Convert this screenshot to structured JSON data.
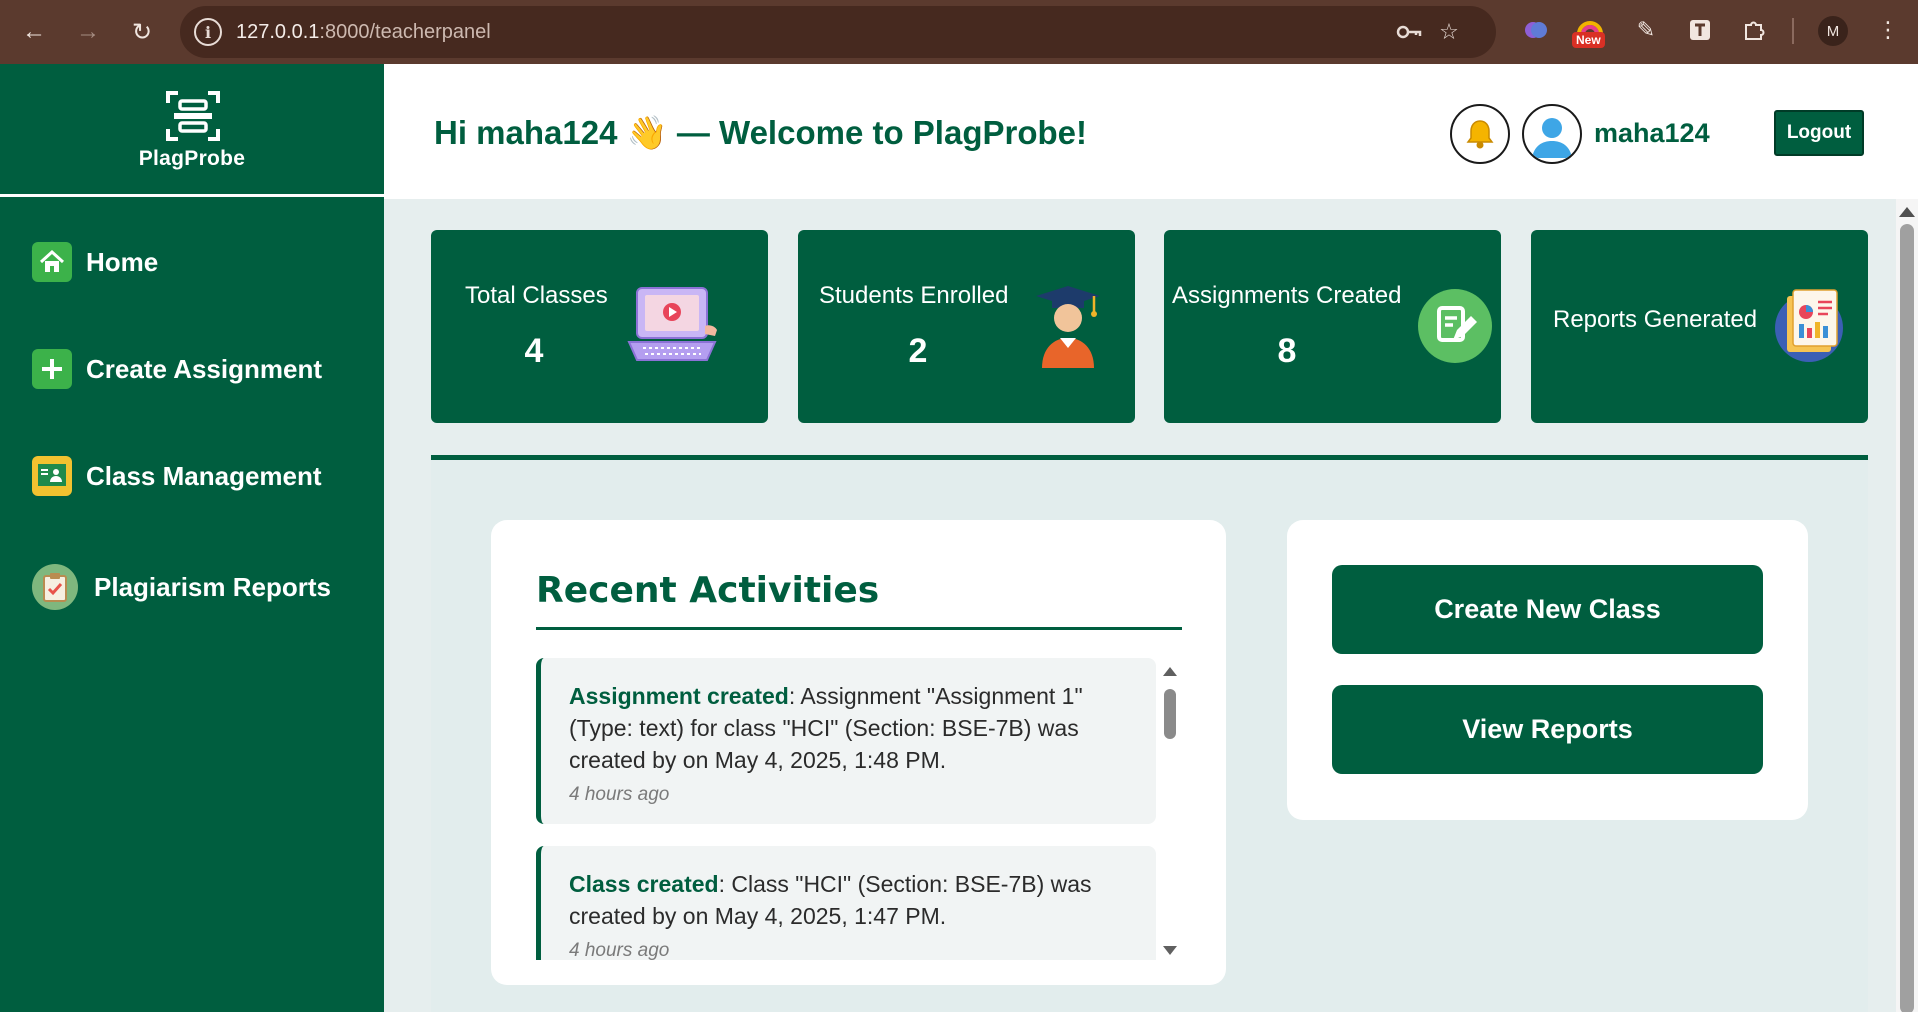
{
  "browser": {
    "url_host": "127.0.0.1",
    "url_path": ":8000/teacherpanel",
    "new_badge": "New",
    "profile_initial": "M"
  },
  "app": {
    "logo_text": "PlagProbe",
    "greeting": "Hi maha124 👋 — Welcome to PlagProbe!",
    "username": "maha124",
    "logout_label": "Logout",
    "accent_color": "#005e3f"
  },
  "sidebar": {
    "items": [
      {
        "label": "Home",
        "icon": "home-icon"
      },
      {
        "label": "Create Assignment",
        "icon": "plus-icon"
      },
      {
        "label": "Class Management",
        "icon": "classroom-icon"
      },
      {
        "label": "Plagiarism Reports",
        "icon": "clipboard-icon"
      }
    ]
  },
  "stats": [
    {
      "label": "Total Classes",
      "value": "4",
      "icon": "laptop-video-icon"
    },
    {
      "label": "Students Enrolled",
      "value": "2",
      "icon": "graduate-icon"
    },
    {
      "label": "Assignments Created",
      "value": "8",
      "icon": "edit-document-icon"
    },
    {
      "label": "Reports Generated",
      "value": "",
      "icon": "report-charts-icon"
    }
  ],
  "activities": {
    "title": "Recent Activities",
    "items": [
      {
        "kind": "Assignment created",
        "text": ": Assignment \"Assignment 1\" (Type: text) for class \"HCI\" (Section: BSE-7B) was created by on May 4, 2025, 1:48 PM.",
        "time": "4 hours ago"
      },
      {
        "kind": "Class created",
        "text": ": Class \"HCI\" (Section: BSE-7B) was created by on May 4, 2025, 1:47 PM.",
        "time": "4 hours ago"
      }
    ]
  },
  "actions": {
    "create_class": "Create New Class",
    "view_reports": "View Reports"
  }
}
